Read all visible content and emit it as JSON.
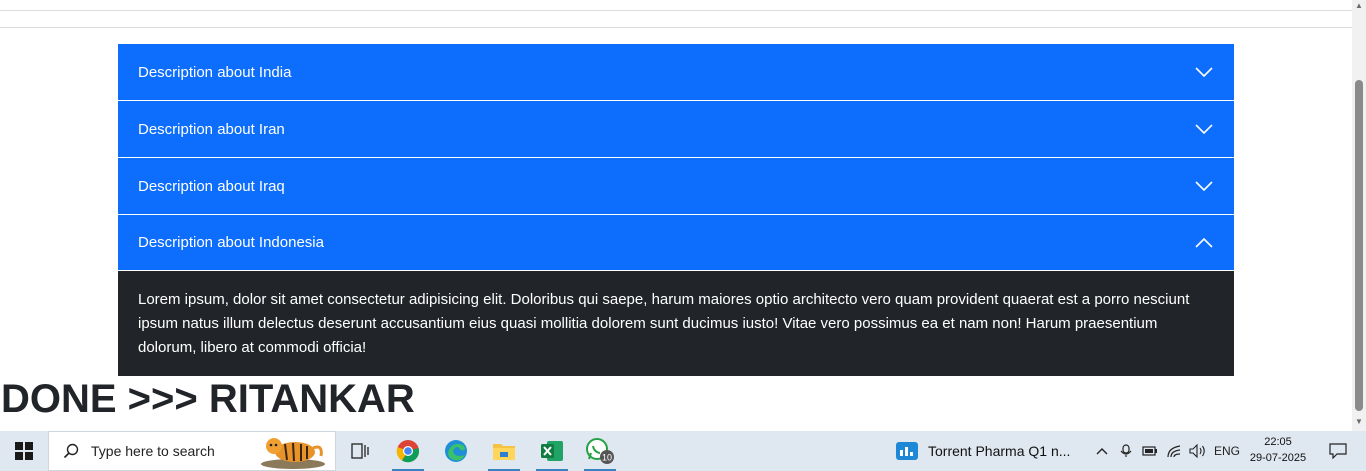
{
  "accordion": {
    "items": [
      {
        "label": "Description about India",
        "state": "collapsed",
        "icon": "chevron-down-icon"
      },
      {
        "label": "Description about Iran",
        "state": "collapsed",
        "icon": "chevron-down-icon"
      },
      {
        "label": "Description about Iraq",
        "state": "collapsed",
        "icon": "chevron-down-icon"
      },
      {
        "label": "Description about Indonesia",
        "state": "expanded",
        "icon": "chevron-up-icon"
      }
    ],
    "expanded_body": "Lorem ipsum, dolor sit amet consectetur adipisicing elit. Doloribus qui saepe, harum maiores optio architecto vero quam provident quaerat est a porro nesciunt ipsum natus illum delectus deserunt accusantium eius quasi mollitia dolorem sunt ducimus iusto! Vitae vero possimus ea et nam non! Harum praesentium dolorum, libero at commodi officia!",
    "colors": {
      "header_bg": "#0d6efd",
      "body_bg": "#212529",
      "text": "#ffffff"
    }
  },
  "heading": "DONE >>> RITANKAR",
  "taskbar": {
    "search_placeholder": "Type here to search",
    "apps": [
      {
        "name": "task-view-icon"
      },
      {
        "name": "chrome-icon",
        "active": true
      },
      {
        "name": "edge-icon"
      },
      {
        "name": "file-explorer-icon",
        "active": true
      },
      {
        "name": "excel-icon",
        "active": true
      },
      {
        "name": "whatsapp-icon",
        "badge": "10",
        "active": true
      }
    ],
    "news_text": "Torrent Pharma Q1 n...",
    "tray": {
      "language": "ENG",
      "time": "22:05",
      "date": "29-07-2025"
    }
  }
}
